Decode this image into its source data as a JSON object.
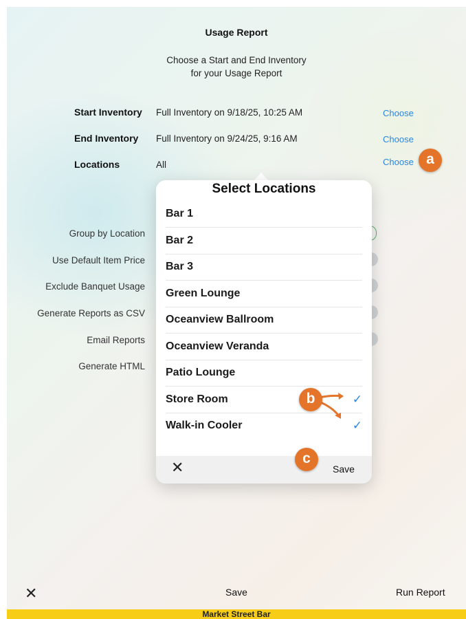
{
  "header": {
    "title": "Usage Report",
    "subtitle_line1": "Choose a Start and End Inventory",
    "subtitle_line2": "for your Usage Report"
  },
  "inventory_rows": [
    {
      "label": "Start Inventory",
      "value": "Full Inventory on 9/18/25, 10:25 AM",
      "action": "Choose"
    },
    {
      "label": "End Inventory",
      "value": "Full Inventory on 9/24/25, 9:16 AM",
      "action": "Choose"
    },
    {
      "label": "Locations",
      "value": "All",
      "action": "Choose"
    }
  ],
  "options": [
    {
      "label": "Group by Location",
      "toggle": "on"
    },
    {
      "label": "Use Default Item Price",
      "toggle": "off"
    },
    {
      "label": "Exclude Banquet Usage",
      "toggle": "off"
    },
    {
      "label": "Generate Reports as CSV",
      "toggle": "off"
    },
    {
      "label": "Email Reports",
      "toggle": "off"
    },
    {
      "label": "Generate HTML",
      "toggle": "off"
    }
  ],
  "popup": {
    "title": "Select Locations",
    "locations": [
      {
        "label": "Bar 1",
        "checked": false
      },
      {
        "label": "Bar 2",
        "checked": false
      },
      {
        "label": "Bar 3",
        "checked": false
      },
      {
        "label": "Green Lounge",
        "checked": false
      },
      {
        "label": "Oceanview Ballroom",
        "checked": false
      },
      {
        "label": "Oceanview Veranda",
        "checked": false
      },
      {
        "label": "Patio Lounge",
        "checked": false
      },
      {
        "label": "Store Room",
        "checked": true
      },
      {
        "label": "Walk-in Cooler",
        "checked": true
      }
    ],
    "close_icon": "close-icon",
    "save_label": "Save",
    "check_glyph": "✓"
  },
  "toolbar": {
    "close_icon": "close-icon",
    "save_label": "Save",
    "run_label": "Run Report"
  },
  "footer": {
    "venue": "Market Street Bar"
  },
  "callouts": {
    "a": "a",
    "b": "b",
    "c": "c"
  },
  "colors": {
    "accent": "#2a86e0",
    "callout": "#e4742a",
    "footer_bg": "#f7cd17",
    "toggle_on": "#4fb26a"
  }
}
